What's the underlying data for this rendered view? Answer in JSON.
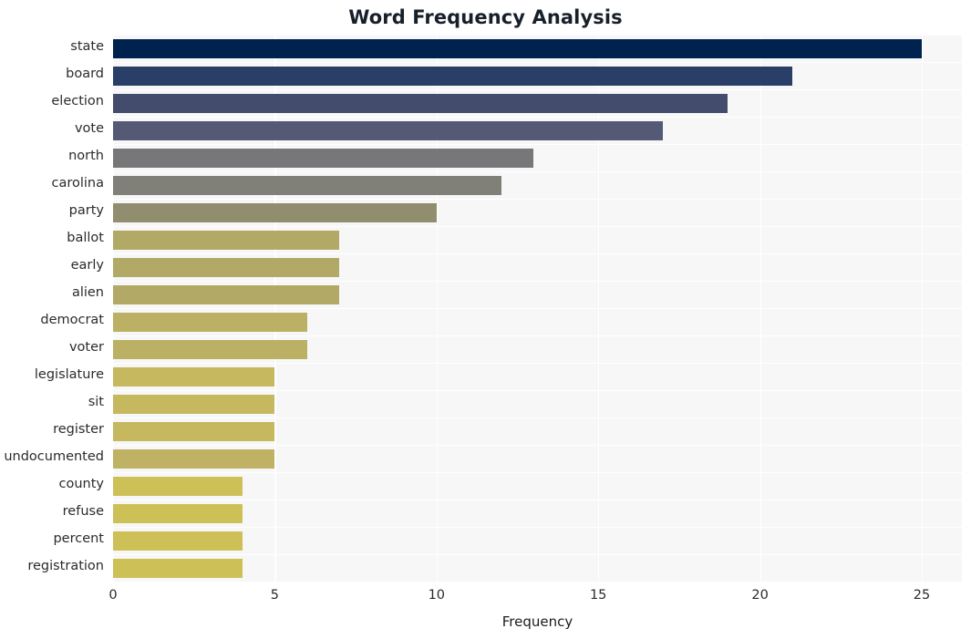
{
  "chart_data": {
    "type": "bar",
    "orientation": "horizontal",
    "title": "Word Frequency Analysis",
    "xlabel": "Frequency",
    "ylabel": "",
    "xlim": [
      0,
      25
    ],
    "xticks": [
      0,
      5,
      10,
      15,
      20,
      25
    ],
    "xticklabels": [
      "0",
      "5",
      "10",
      "15",
      "20",
      "25"
    ],
    "grid": true,
    "legend": false,
    "plot_background": "#f7f7f7",
    "grid_color": "#ffffff",
    "tick_label_color": "#2b2b2b",
    "title_color": "#17202a",
    "colormap": "cividis",
    "categories": [
      "state",
      "board",
      "election",
      "vote",
      "north",
      "carolina",
      "party",
      "ballot",
      "early",
      "alien",
      "democrat",
      "voter",
      "legislature",
      "sit",
      "register",
      "undocumented",
      "county",
      "refuse",
      "percent",
      "registration"
    ],
    "values": [
      25,
      21,
      19,
      17,
      13,
      12,
      10,
      7,
      7,
      7,
      6,
      6,
      5,
      5,
      5,
      5,
      4,
      4,
      4,
      4
    ],
    "bar_colors": [
      "#00224e",
      "#2a3f६8",
      "#444c६e",
      "#54587५",
      "#77777८",
      "#82806e",
      "#928f६८",
      "#b4a863",
      "#b4a863",
      "#b4a863",
      "#bcae60",
      "#bcae60",
      "#c3b55d",
      "#c3b55d",
      "#c3b55d",
      "#c3b55d",
      "#cbbc५९",
      "#cbbc59",
      "#cbbc59",
      "#cbbc59"
    ]
  },
  "bars": [
    {
      "label": "state",
      "value": 25,
      "color": "#00224e"
    },
    {
      "label": "board",
      "value": 21,
      "color": "#2a3f68"
    },
    {
      "label": "election",
      "value": 19,
      "color": "#444c6e"
    },
    {
      "label": "vote",
      "value": 17,
      "color": "#545a75"
    },
    {
      "label": "north",
      "value": 13,
      "color": "#777779"
    },
    {
      "label": "carolina",
      "value": 12,
      "color": "#807f78"
    },
    {
      "label": "party",
      "value": 10,
      "color": "#918e6f"
    },
    {
      "label": "ballot",
      "value": 7,
      "color": "#b3a967"
    },
    {
      "label": "early",
      "value": 7,
      "color": "#b3a967"
    },
    {
      "label": "alien",
      "value": 7,
      "color": "#b3a967"
    },
    {
      "label": "democrat",
      "value": 6,
      "color": "#bbb063"
    },
    {
      "label": "voter",
      "value": 6,
      "color": "#bbb063"
    },
    {
      "label": "legislature",
      "value": 5,
      "color": "#c5b85f"
    },
    {
      "label": "sit",
      "value": 5,
      "color": "#c5b85f"
    },
    {
      "label": "register",
      "value": 5,
      "color": "#c5b85f"
    },
    {
      "label": "undocumented",
      "value": 5,
      "color": "#bfb265"
    },
    {
      "label": "county",
      "value": 4,
      "color": "#cdc057"
    },
    {
      "label": "refuse",
      "value": 4,
      "color": "#cdc057"
    },
    {
      "label": "percent",
      "value": 4,
      "color": "#cdc057"
    },
    {
      "label": "registration",
      "value": 4,
      "color": "#cdc057"
    }
  ]
}
